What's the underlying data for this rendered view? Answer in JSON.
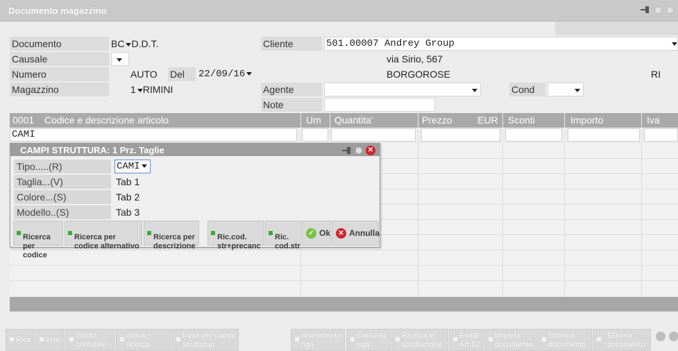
{
  "window": {
    "title": "Documento magazzino"
  },
  "header": {
    "documento_label": "Documento",
    "documento_code": "BC",
    "documento_type": "D.D.T.",
    "causale_label": "Causale",
    "numero_label": "Numero",
    "numero_value": "AUTO",
    "del_label": "Del",
    "date_value": "22/09/16",
    "magazzino_label": "Magazzino",
    "magazzino_code": "1",
    "magazzino_name": "RIMINI",
    "cliente_label": "Cliente",
    "cliente_value": "501.00007 Andrey Group",
    "address_line1": "via Sirio, 567",
    "address_line2": "BORGOROSE",
    "province": "RI",
    "agente_label": "Agente",
    "cond_label": "Cond",
    "note_label": "Note"
  },
  "grid": {
    "columns": [
      "0001",
      "Codice e descrizione articolo",
      "Um",
      "Quantita'",
      "Prezzo",
      "EUR",
      "Sconti",
      "Importo",
      "Iva"
    ],
    "current_code": "CAMI"
  },
  "popup": {
    "title": "CAMPI STRUTTURA: 1 Prz. Taglie",
    "fields": [
      {
        "label": "Tipo.....(R)",
        "value": "CAMI"
      },
      {
        "label": "Taglia...(V)",
        "value": "Tab 1"
      },
      {
        "label": "Colore...(S)",
        "value": "Tab 2"
      },
      {
        "label": "Modello..(S)",
        "value": "Tab 3"
      }
    ],
    "buttons": [
      {
        "label": "Ricerca\nper codice"
      },
      {
        "label": "Ricerca per\ncodice alternativo"
      },
      {
        "label": "Ricerca per\ndescrizione"
      },
      {
        "label": "Ric.cod.\nstr+precanc"
      },
      {
        "label": "Ric.\ncod.str"
      }
    ],
    "ok_label": "Ok",
    "cancel_label": "Annulla"
  },
  "bottombar": {
    "buttons": [
      {
        "label": "Rice"
      },
      {
        "label": "Inse"
      },
      {
        "label": "Valuta\ncontabile"
      },
      {
        "label": "Attiva ricerca\nestesa"
      },
      {
        "label": "Input per campi\nstrutturati"
      },
      {
        "label": "Inserimento\nriga"
      },
      {
        "label": "Cancella\nriga"
      },
      {
        "label": "Ricerca e\nsostituzione"
      },
      {
        "label": "Evadi\nArt.62"
      },
      {
        "label": "Importa\ndocumento"
      },
      {
        "label": "Stampa\ndocumento"
      },
      {
        "label": "Elimina\ndocumento"
      }
    ]
  },
  "icons": {
    "pin": "pin-icon",
    "minimize": "circle-icon",
    "close": "close-icon",
    "ok": "check-icon",
    "cancel": "cancel-icon",
    "trash": "trash-icon"
  },
  "colors": {
    "titlebar": "#c9c9c9",
    "grid_header": "#a9a9a9",
    "popup_title": "#9d9d9d",
    "ok_green": "#7bc043",
    "cancel_red": "#d2232a",
    "focus_blue": "#5b8ad6"
  }
}
